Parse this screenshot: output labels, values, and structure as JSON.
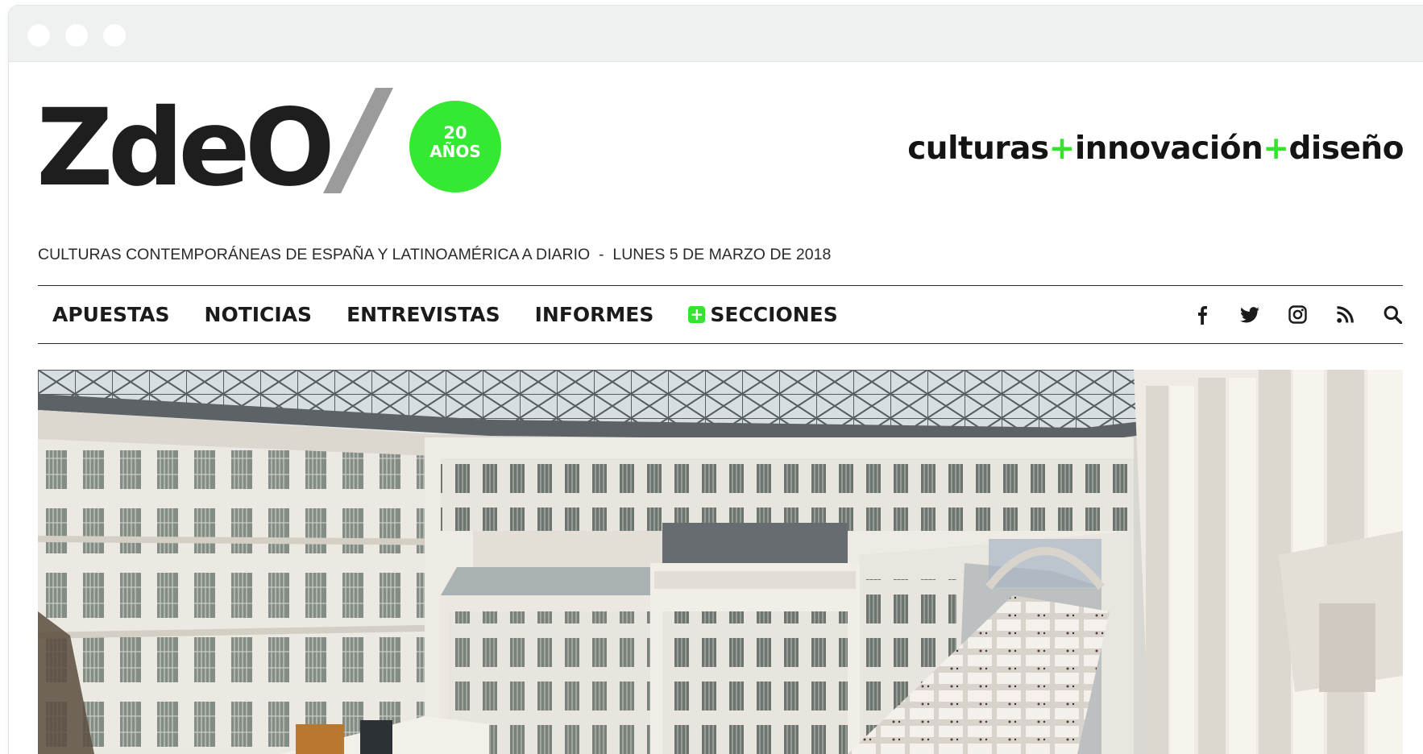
{
  "window": {
    "controls": [
      "close",
      "minimize",
      "maximize"
    ]
  },
  "brand": {
    "logo": "ZdeO",
    "badge_number": "20",
    "badge_label": "AÑOS",
    "slogan": [
      "culturas",
      "+",
      "innovación",
      "+",
      "diseño"
    ],
    "tagline": "CULTURAS CONTEMPORÁNEAS DE ESPAÑA Y LATINOAMÉRICA A DIARIO  -  LUNES 5 DE MARZO DE 2018"
  },
  "nav": {
    "items": [
      "APUESTAS",
      "NOTICIAS",
      "ENTREVISTAS",
      "INFORMES",
      "SECCIONES"
    ],
    "icons": [
      "facebook-icon",
      "twitter-icon",
      "instagram-icon",
      "rss-icon",
      "search-icon"
    ]
  },
  "colors": {
    "accent_green": "#35e932",
    "text_dark": "#1e1e1e",
    "slash_gray": "#9b9b9b",
    "titlebar": "#eff0f0"
  },
  "hero": {
    "image": "palace-atrium-art-fair-photo"
  }
}
